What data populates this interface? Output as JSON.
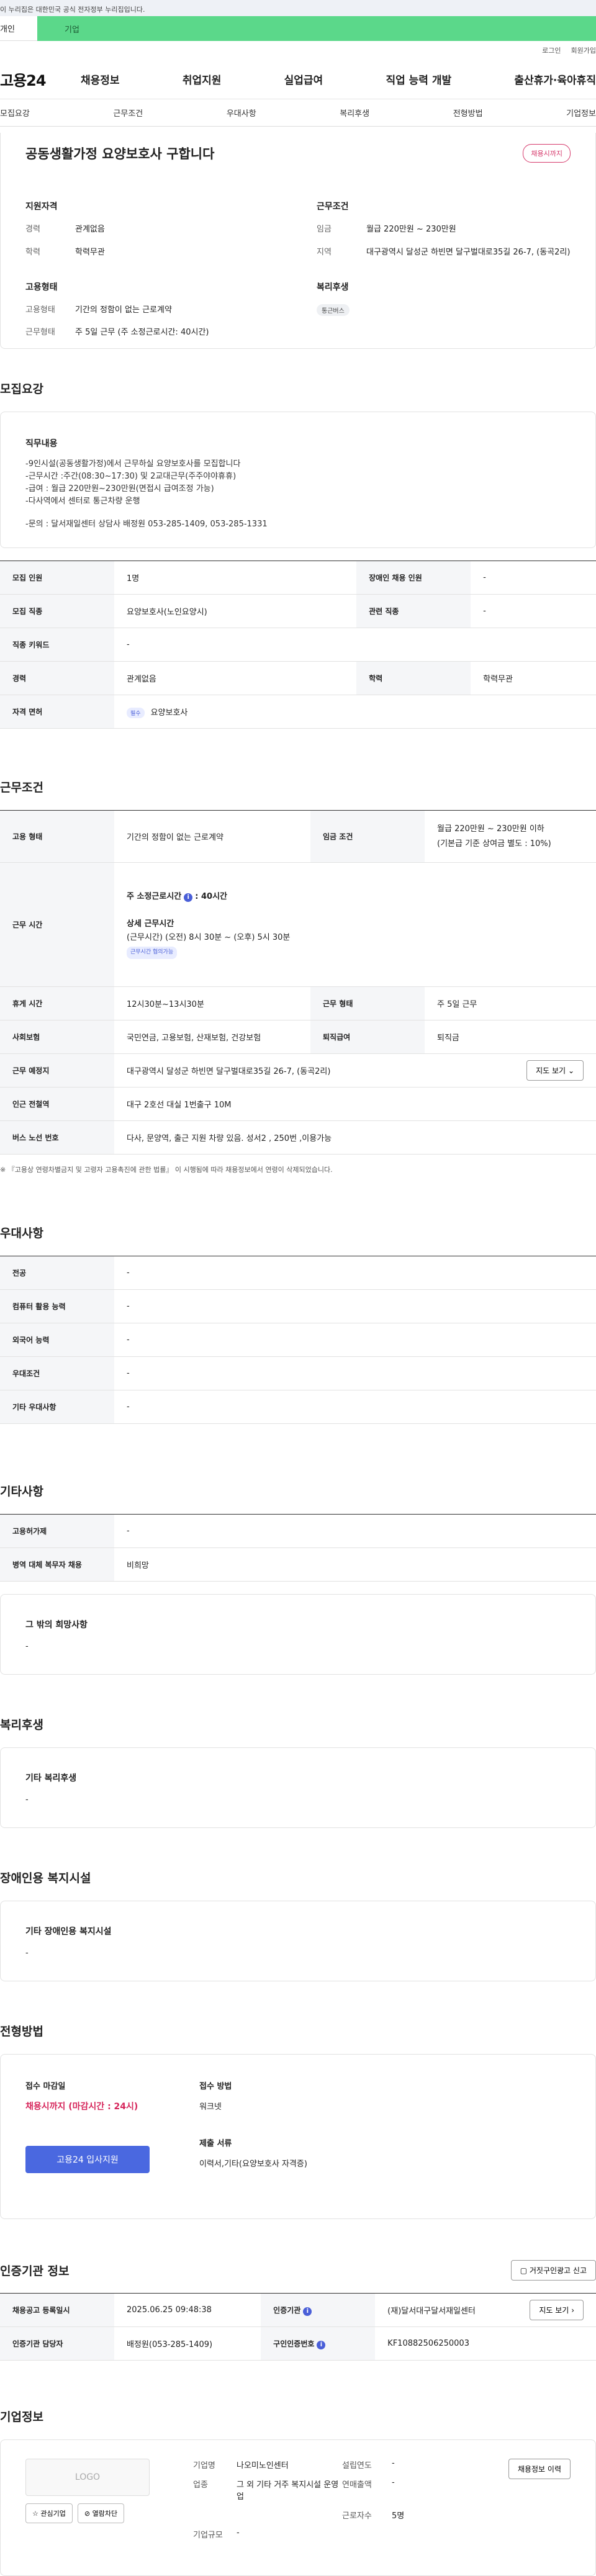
{
  "header": {
    "gov_banner": "이 누리집은 대한민국 공식 전자정부 누리집입니다.",
    "tab_personal": "개인",
    "tab_company": "기업",
    "top_links": [
      "로그인",
      "회원가입"
    ],
    "logo": "고용24",
    "gnb": [
      "채용정보",
      "취업지원",
      "실업급여",
      "직업 능력 개발",
      "출산휴가·육아휴직"
    ]
  },
  "anchors": [
    "모집요강",
    "근무조건",
    "우대사항",
    "복리후생",
    "전형방법",
    "기업정보"
  ],
  "summary": {
    "title": "공동생활가정 요양보호사 구합니다",
    "deadline_badge": "채용시까지",
    "qual_title": "지원자격",
    "career_k": "경력",
    "career_v": "관계없음",
    "edu_k": "학력",
    "edu_v": "학력무관",
    "emp_title": "고용형태",
    "emptype_k": "고용형태",
    "emptype_v": "기간의 정함이 없는 근로계약",
    "workform_k": "근무형태",
    "workform_v": "주 5일 근무 (주 소정근로시간: 40시간)",
    "cond_title": "근무조건",
    "wage_k": "임금",
    "wage_v": "월급 220만원 ~ 230만원",
    "area_k": "지역",
    "area_v": "대구광역시 달성군 하빈면 달구벌대로35길 26-7, (동곡2리)",
    "welfare_title": "복리후생",
    "welfare_pill": "통근버스"
  },
  "recruit": {
    "section": "모집요강",
    "duty_title": "직무내용",
    "duty_lines": [
      "-9인시설(공동생활가정)에서 근무하실 요양보호사를 모집합니다",
      "-근무시간 :주간(08:30~17:30) 및  2교대근무(주주야야휴휴)",
      "-급여 : 월급 220만원~230만원(면접시 급여조정 가능)",
      "-다사역에서 센터로 통근차량 운행",
      "",
      "-문의 : 달서재일센터 상담사 배정원 053-285-1409, 053-285-1331"
    ],
    "rows": {
      "count_k": "모집 인원",
      "count_v": "1명",
      "disabled_k": "장애인 채용 인원",
      "disabled_v": "-",
      "job_k": "모집 직종",
      "job_v": "요양보호사(노인요양시)",
      "related_k": "관련 직종",
      "related_v": "-",
      "keyword_k": "직종 키워드",
      "keyword_v": "-",
      "career_k": "경력",
      "career_v": "관계없음",
      "edu_k": "학력",
      "edu_v": "학력무관",
      "license_k": "자격 면허",
      "license_tag": "필수",
      "license_v": "요양보호사"
    }
  },
  "work": {
    "section": "근무조건",
    "emptype_k": "고용 형태",
    "emptype_v": "기간의 정함이 없는 근로계약",
    "wagecond_k": "임금 조건",
    "wage_line1": "월급 220만원 ~ 230만원 이하",
    "wage_line2": "(기본급 기준 상여금 별도 : 10%)",
    "hours_k": "근무 시간",
    "hours_week": "주 소정근로시간",
    "hours_week_v": ": 40시간",
    "hours_detail_title": "상세 근무시간",
    "hours_detail_1": "(근무시간) (오전) 8시 30분 ~ (오후) 5시 30분",
    "hours_tag": "근무시간 협의가능",
    "break_k": "휴게 시간",
    "break_v": "12시30분~13시30분",
    "form_k": "근무 형태",
    "form_v": "주 5일 근무",
    "insure_k": "사회보험",
    "insure_v": "국민연금, 고용보험, 산재보험, 건강보험",
    "retire_k": "퇴직급여",
    "retire_v": "퇴직금",
    "place_k": "근무 예정지",
    "place_v": "대구광역시 달성군 하빈면 달구벌대로35길 26-7, (동곡2리)",
    "map_btn": "지도 보기",
    "subway_k": "인근 전철역",
    "subway_v": "대구 2호선 대실 1번출구 10M",
    "bus_k": "버스 노선 번호",
    "bus_v": "다사, 문양역, 출근 지원 차량 있음. 성서2 , 250번 ,이용가능",
    "note": "※ 『고용상 연령차별금지 및 고령자 고용촉진에 관한 법률』 이 시행됨에 따라 채용정보에서 연령이 삭제되었습니다."
  },
  "pref": {
    "section": "우대사항",
    "major_k": "전공",
    "major_v": "-",
    "computer_k": "컴퓨터 활용 능력",
    "computer_v": "-",
    "lang_k": "외국어 능력",
    "lang_v": "-",
    "cond_k": "우대조건",
    "cond_v": "-",
    "etc_k": "기타 우대사항",
    "etc_v": "-"
  },
  "etc": {
    "section": "기타사항",
    "retire_k": "고용허가제",
    "retire_v": "-",
    "military_k": "병역 대체 복무자 채용",
    "military_v": "비희망",
    "other_title": "그 밖의 희망사항",
    "other_v": "-"
  },
  "welfare": {
    "section": "복리후생",
    "title": "기타 복리후생",
    "v": "-"
  },
  "disabled": {
    "section": "장애인용 복지시설",
    "title": "기타 장애인용 복지시설",
    "v": "-"
  },
  "apply": {
    "section": "전형방법",
    "deadline_title": "접수 마감일",
    "deadline_v": "채용시까지 (마감시간 : 24시)",
    "method_title": "접수 방법",
    "method_v": "워크넷",
    "docs_title": "제출 서류",
    "docs_v": "이력서,기타(요양보호사 자격증)",
    "apply_btn": "고용24 입사지원"
  },
  "agency": {
    "section": "인증기관 정보",
    "report_btn": "거짓구인광고 신고",
    "reg_k": "채용공고 등록일시",
    "reg_v": "2025.06.25 09:48:38",
    "org_k": "인증기관",
    "org_v": "(재)달서대구달서재일센터",
    "map_btn": "지도 보기",
    "staff_k": "인증기관 담당자",
    "staff_v": "배정원(053-285-1409)",
    "num_k": "구인인증번호",
    "num_v": "KF10882506250003"
  },
  "company": {
    "section": "기업정보",
    "logo": "LOGO",
    "fav_btn": "관심기업",
    "block_btn": "열람차단",
    "history_btn": "채용정보 이력",
    "name_k": "기업명",
    "name_v": "나오미노인센터",
    "year_k": "설립연도",
    "year_v": "-",
    "industry_k": "업종",
    "industry_v": "그 외 기타 거주 복지시설 운영업",
    "sales_k": "연매출액",
    "sales_v": "-",
    "emp_k": "근로자수",
    "emp_v": "5명",
    "size_k": "기업규모",
    "size_v": "-"
  }
}
